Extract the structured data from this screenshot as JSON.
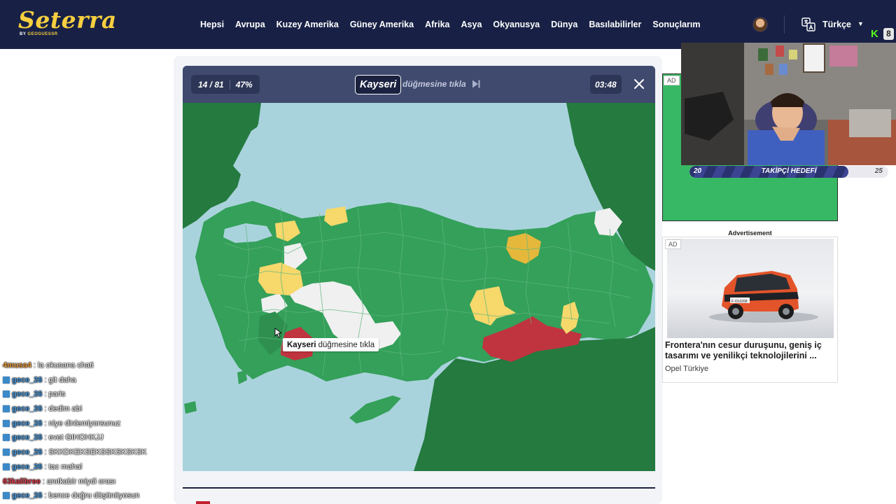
{
  "site": {
    "logo_text": "Seterra",
    "logo_sub_prefix": "BY ",
    "logo_sub_brand": "GEOGUESSR"
  },
  "nav": {
    "items": [
      {
        "label": "Hepsi"
      },
      {
        "label": "Avrupa"
      },
      {
        "label": "Kuzey Amerika"
      },
      {
        "label": "Güney Amerika"
      },
      {
        "label": "Afrika"
      },
      {
        "label": "Asya"
      },
      {
        "label": "Okyanusya"
      },
      {
        "label": "Dünya"
      },
      {
        "label": "Basılabilirler"
      },
      {
        "label": "Sonuçlarım"
      }
    ],
    "language": "Türkçe"
  },
  "game": {
    "progress": "14 / 81",
    "percent": "47%",
    "target": "Kayseri",
    "instruction": "düğmesine tıkla",
    "timer": "03:48",
    "tooltip_target": "Kayseri",
    "tooltip_text": "düğmesine tıkla",
    "colors": {
      "sea": "#a9d3dc",
      "correct_first": "#2e8f4e",
      "correct": "#34a05a",
      "foreign": "#247a3f",
      "second_try": "#f6d86b",
      "third_try": "#e5b83c",
      "wrong": "#c0343f",
      "unanswered": "#f0f0f0"
    }
  },
  "chat": {
    "messages": [
      {
        "user": "4musa4",
        "text": ": la okusana chati",
        "color": "#f0a040",
        "badge": false
      },
      {
        "user": "gece_26",
        "text": ": git daha",
        "color": "#4a9be0",
        "badge": true
      },
      {
        "user": "gece_26",
        "text": ": paris",
        "color": "#4a9be0",
        "badge": true
      },
      {
        "user": "gece_26",
        "text": ": dedim abi",
        "color": "#4a9be0",
        "badge": true
      },
      {
        "user": "gece_26",
        "text": ": niye dinlemiyorsunuz",
        "color": "#4a9be0",
        "badge": true
      },
      {
        "user": "gece_26",
        "text": ": evet GIHOHKJJ",
        "color": "#4a9be0",
        "badge": true
      },
      {
        "user": "gece_26",
        "text": ": SKKDKEKSEKSSKSKSKSK",
        "color": "#4a9be0",
        "badge": true
      },
      {
        "user": "gece_26",
        "text": ": tac mahal",
        "color": "#4a9be0",
        "badge": true
      },
      {
        "user": "63kalibree",
        "text": ": anıtkabir miydi orası",
        "color": "#e03a4a",
        "badge": false
      },
      {
        "user": "gece_26",
        "text": ": bence doğru düşünüyosun",
        "color": "#4a9be0",
        "badge": true
      }
    ]
  },
  "ads": {
    "top_badge": "AD",
    "caption": "Advertisement",
    "badge": "AD",
    "headline": "Frontera'nın cesur duruşunu, geniş iç tasarımı ve yenilikçi teknolojilerini ...",
    "brand": "Opel Türkiye",
    "plate": "F·OL6268"
  },
  "stream": {
    "goal_start": "20",
    "goal_label": "TAKİPÇİ HEDEFİ",
    "goal_end": "25",
    "goal_progress": 0.8,
    "kick_logo": "K",
    "kick_badge": "8"
  }
}
